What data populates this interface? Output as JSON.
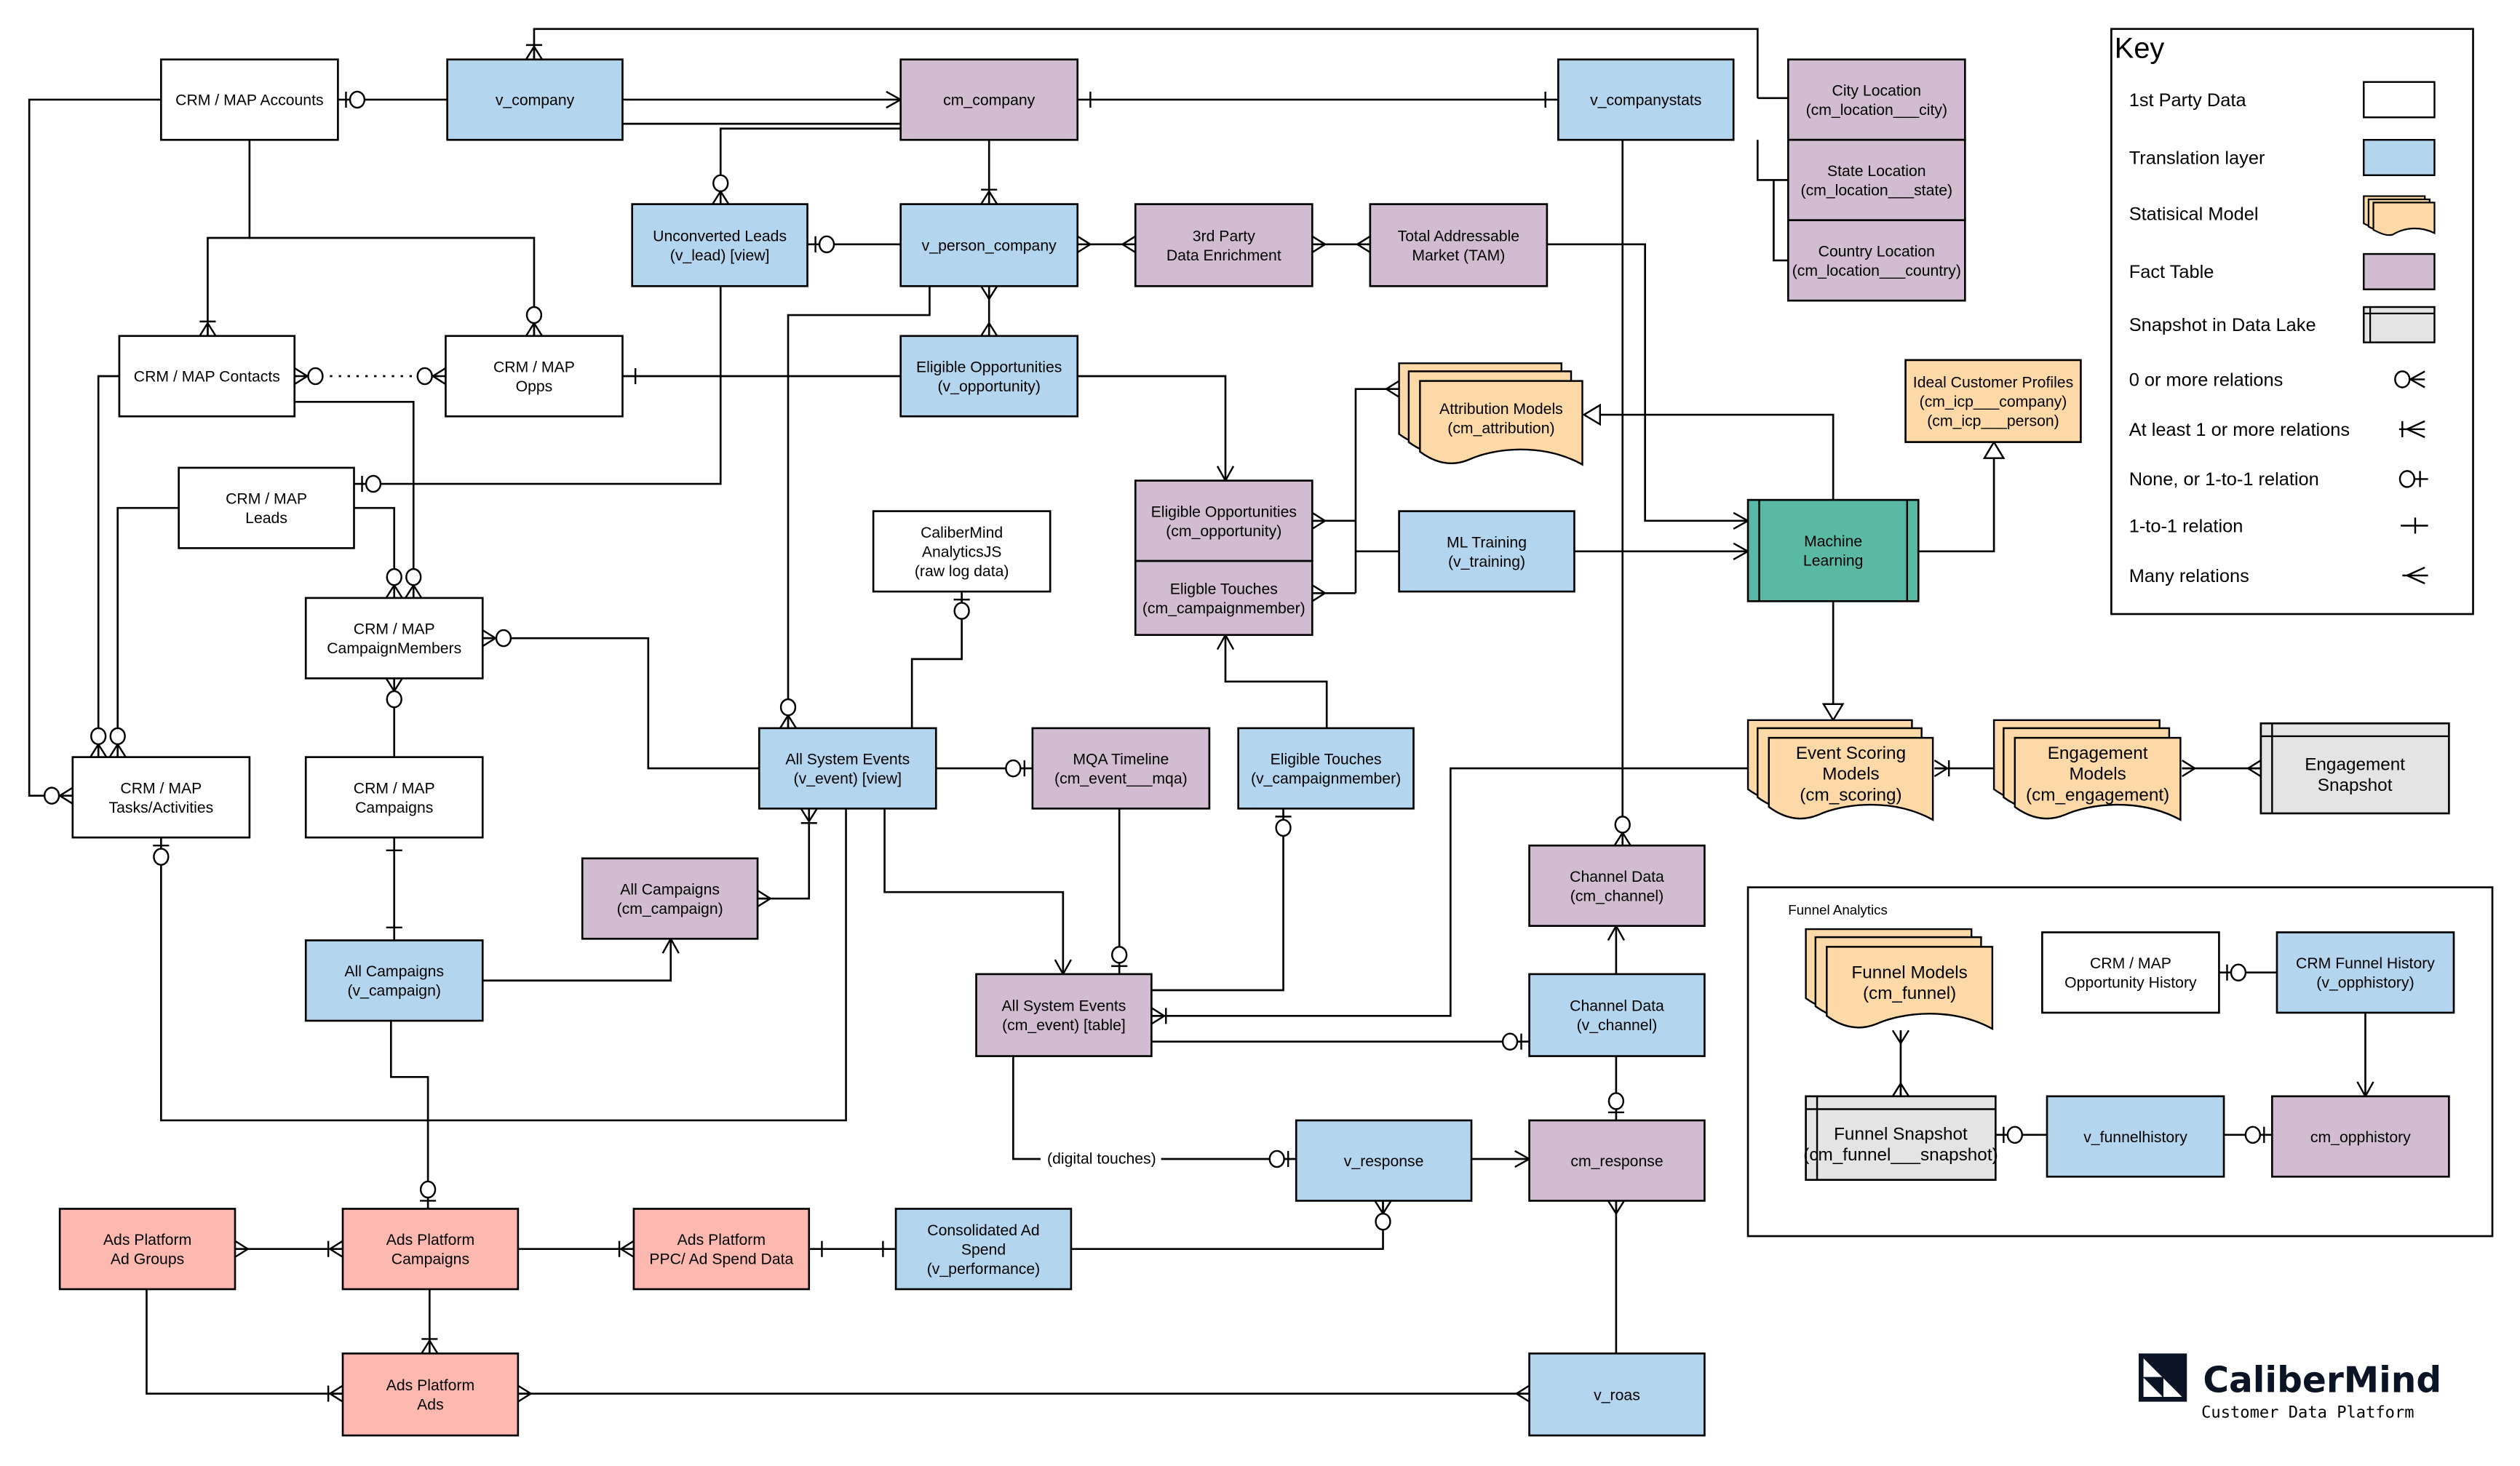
{
  "colors": {
    "first_party": "#ffffff",
    "translation": "#b3d6ee",
    "model": "#fdd9a8",
    "fact": "#d1bcd1",
    "snapshot": "#e4e4e4",
    "ml": "#5ab9a5",
    "ads": "#fdb9b0",
    "brand": "#0b1424"
  },
  "nodes": {
    "crm_accounts": [
      "CRM / MAP Accounts"
    ],
    "v_company": [
      "v_company"
    ],
    "cm_company": [
      "cm_company"
    ],
    "v_companystats": [
      "v_companystats"
    ],
    "city_location": [
      "City Location",
      "(cm_location___city)"
    ],
    "state_location": [
      "State Location",
      "(cm_location___state)"
    ],
    "country_location": [
      "Country Location",
      "(cm_location___country)"
    ],
    "unconverted_leads": [
      "Unconverted Leads",
      "(v_lead) [view]"
    ],
    "v_person_company": [
      "v_person_company"
    ],
    "third_party": [
      "3rd Party",
      "Data Enrichment"
    ],
    "tam": [
      "Total Addressable",
      "Market (TAM)"
    ],
    "crm_contacts": [
      "CRM / MAP Contacts"
    ],
    "crm_opps": [
      "CRM / MAP",
      "Opps"
    ],
    "eligible_opps_v": [
      "Eligible Opportunities",
      "(v_opportunity)"
    ],
    "attribution_models": [
      "Attribution Models",
      "(cm_attribution)"
    ],
    "icp": [
      "Ideal Customer Profiles",
      "(cm_icp___company)",
      "(cm_icp___person)"
    ],
    "crm_leads": [
      "CRM / MAP",
      "Leads"
    ],
    "analyticsjs": [
      "CaliberMind",
      "AnalyticsJS",
      "(raw log data)"
    ],
    "eligible_opps_cm": [
      "Eligible Opportunities",
      "(cm_opportunity)"
    ],
    "eligible_touches_cm": [
      "Eligble Touches",
      "(cm_campaignmember)"
    ],
    "ml_training": [
      "ML Training",
      "(v_training)"
    ],
    "machine_learning": [
      "Machine",
      "Learning"
    ],
    "crm_campaignmembers": [
      "CRM / MAP",
      "CampaignMembers"
    ],
    "crm_tasks": [
      "CRM / MAP",
      "Tasks/Activities"
    ],
    "crm_campaigns": [
      "CRM / MAP",
      "Campaigns"
    ],
    "all_events_v": [
      "All System Events",
      "(v_event) [view]"
    ],
    "mqa_timeline": [
      "MQA Timeline",
      "(cm_event___mqa)"
    ],
    "eligible_touches_v": [
      "Eligible Touches",
      "(v_campaignmember)"
    ],
    "event_scoring": [
      "Event Scoring",
      "Models",
      "(cm_scoring)"
    ],
    "engagement_models": [
      "Engagement",
      "Models",
      "(cm_engagement)"
    ],
    "engagement_snapshot": [
      "Engagement",
      "Snapshot"
    ],
    "all_campaigns_cm": [
      "All Campaigns",
      "(cm_campaign)"
    ],
    "channel_cm": [
      "Channel Data",
      "(cm_channel)"
    ],
    "all_campaigns_v": [
      "All Campaigns",
      "(v_campaign)"
    ],
    "all_events_cm": [
      "All System Events",
      "(cm_event) [table]"
    ],
    "channel_v": [
      "Channel Data",
      "(v_channel)"
    ],
    "v_response": [
      "v_response"
    ],
    "cm_response": [
      "cm_response"
    ],
    "ads_ad_groups": [
      "Ads Platform",
      "Ad Groups"
    ],
    "ads_campaigns": [
      "Ads Platform",
      "Campaigns"
    ],
    "ads_ppc": [
      "Ads Platform",
      "PPC/ Ad Spend Data"
    ],
    "consolidated_spend": [
      "Consolidated Ad",
      "Spend",
      "(v_performance)"
    ],
    "ads_ads": [
      "Ads Platform",
      "Ads"
    ],
    "v_roas": [
      "v_roas"
    ],
    "funnel_models": [
      "Funnel Models",
      "(cm_funnel)"
    ],
    "crm_opp_history": [
      "CRM / MAP",
      "Opportunity History"
    ],
    "crm_funnel_history": [
      "CRM Funnel History",
      "(v_opphistory)"
    ],
    "funnel_snapshot": [
      "Funnel Snapshot",
      "(cm_funnel___snapshot)"
    ],
    "v_funnelhistory": [
      "v_funnelhistory"
    ],
    "cm_opphistory": [
      "cm_opphistory"
    ]
  },
  "edge_labels": {
    "digital_touches": "(digital touches)"
  },
  "funnel_group": {
    "title": "Funnel Analytics"
  },
  "key": {
    "title": "Key",
    "items": [
      {
        "label": "1st Party Data",
        "symbol": "white-box"
      },
      {
        "label": "Translation layer",
        "symbol": "blue-box"
      },
      {
        "label": "Statisical Model",
        "symbol": "document-stack"
      },
      {
        "label": "Fact Table",
        "symbol": "purple-box"
      },
      {
        "label": "Snapshot in Data Lake",
        "symbol": "snapshot-box"
      },
      {
        "label": "0 or more relations",
        "symbol": "zero-or-many"
      },
      {
        "label": "At least 1 or more relations",
        "symbol": "one-or-many"
      },
      {
        "label": "None, or 1-to-1 relation",
        "symbol": "zero-or-one"
      },
      {
        "label": "1-to-1 relation",
        "symbol": "one-to-one"
      },
      {
        "label": "Many relations",
        "symbol": "many"
      }
    ]
  },
  "brand": {
    "name": "CaliberMind",
    "tagline": "Customer Data Platform"
  }
}
